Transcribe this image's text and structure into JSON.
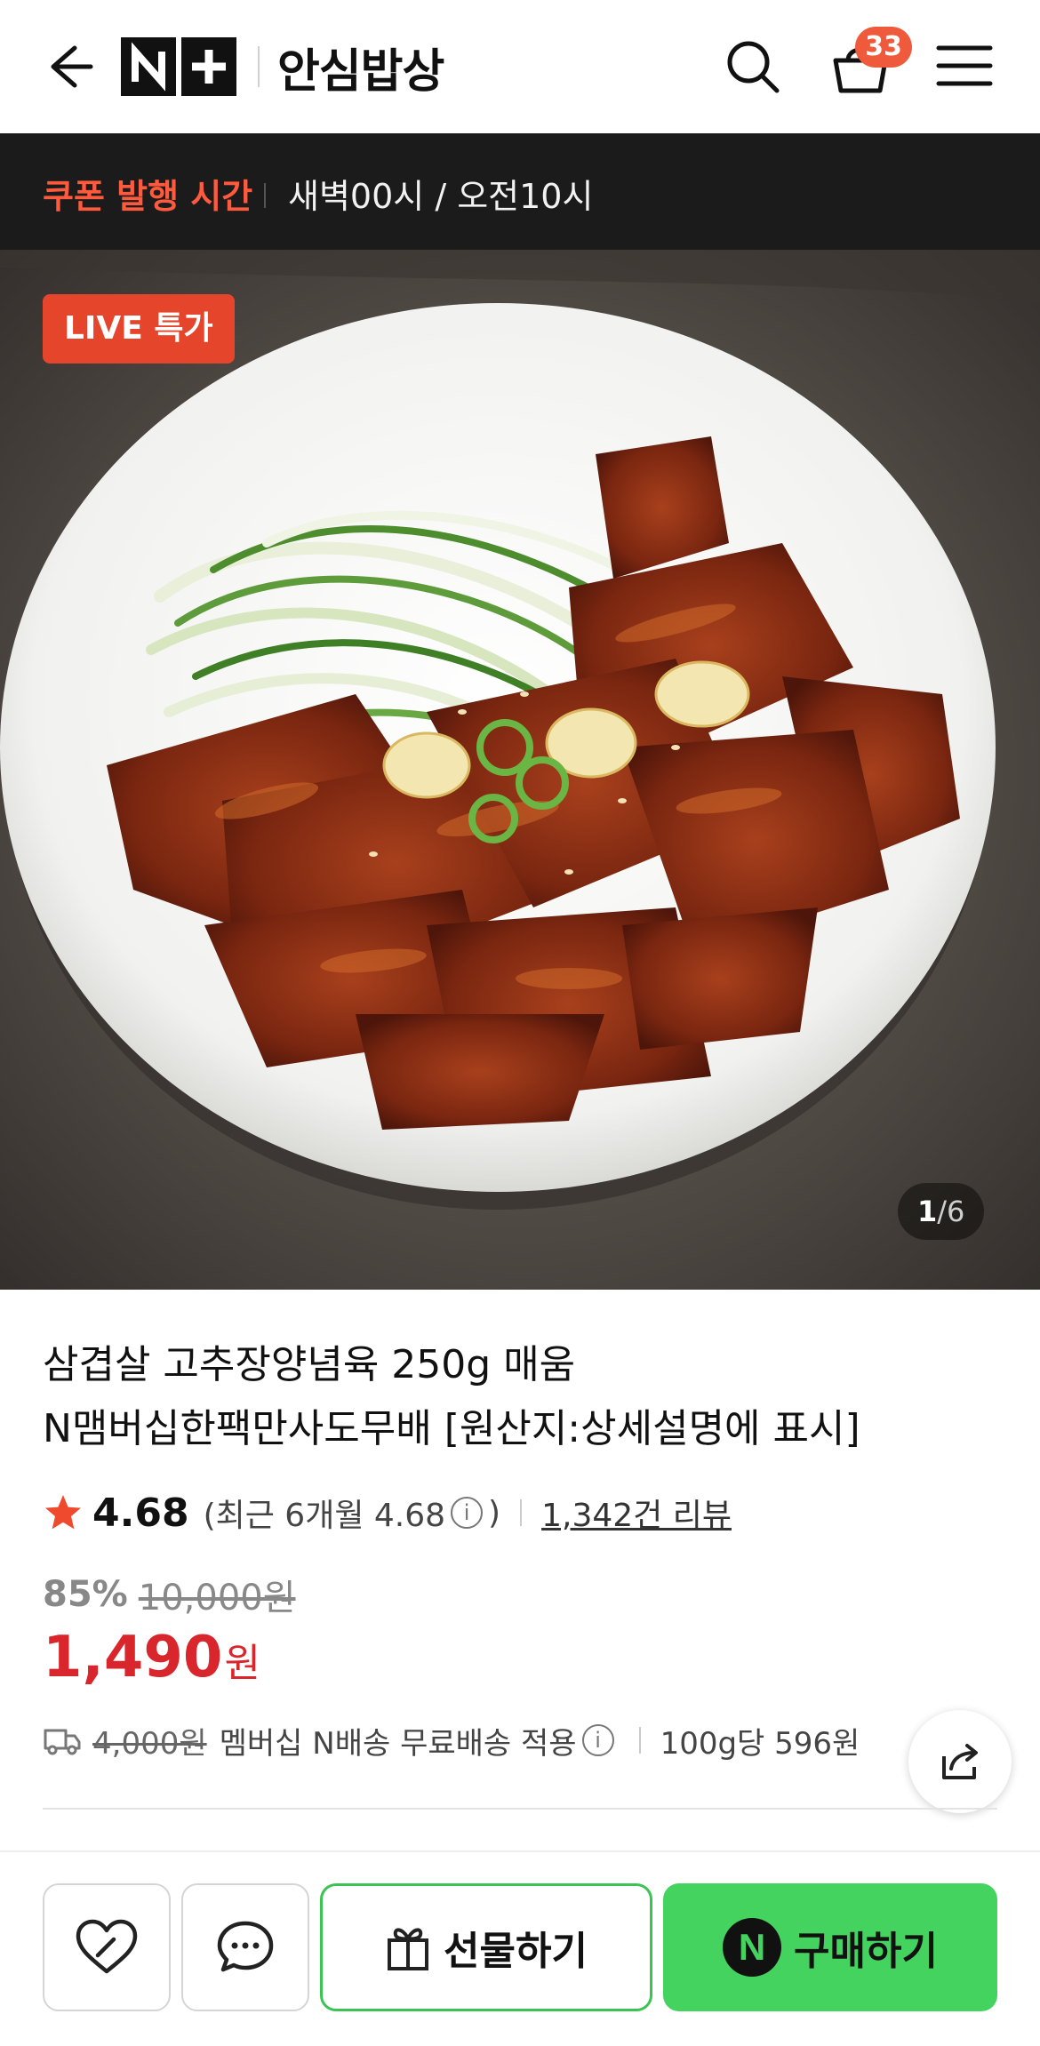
{
  "header": {
    "brand": "안심밥상",
    "logo_text": "N+",
    "cart_count": "33",
    "icons": [
      "back-arrow-icon",
      "search-icon",
      "cart-icon",
      "menu-icon"
    ]
  },
  "coupon_bar": {
    "label": "쿠폰 발행 시간",
    "time": "새벽00시 / 오전10시"
  },
  "hero": {
    "badge": "LIVE 특가",
    "pager_current": "1",
    "pager_total": "/6"
  },
  "product": {
    "title_line1": "삼겹살 고추장양념육 250g 매움",
    "title_line2": "N맴버십한팩만사도무배 [원산지:상세설명에 표시]",
    "rating": "4.68",
    "recent_rating": "(최근 6개월 4.68",
    "recent_rating_close": ")",
    "reviews": "1,342건 리뷰",
    "discount_pct": "85%",
    "original_price": "10,000원",
    "price": "1,490",
    "price_unit": "원",
    "shipping_fee": "4,000원",
    "shipping_note": "멤버십 N배송 무료배송 적용",
    "unit_price": "100g당 596원"
  },
  "bottom_bar": {
    "gift_label": "선물하기",
    "buy_label": "구매하기",
    "buy_logo": "N"
  },
  "colors": {
    "accent_red": "#d9262c",
    "coupon_red": "#ff5a3d",
    "buy_green": "#44d35f",
    "badge_orange": "#ef5a3c"
  }
}
